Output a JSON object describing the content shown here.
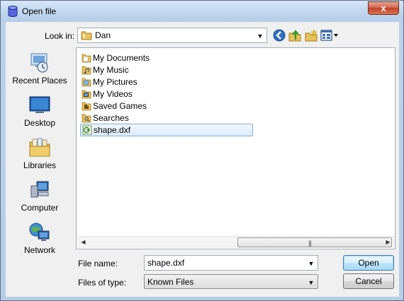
{
  "window": {
    "title": "Open file",
    "close_label": "x"
  },
  "lookin": {
    "label": "Look in:",
    "value": "Dan"
  },
  "places": [
    {
      "label": "Recent Places",
      "icon": "recent-places-icon"
    },
    {
      "label": "Desktop",
      "icon": "desktop-icon"
    },
    {
      "label": "Libraries",
      "icon": "libraries-icon"
    },
    {
      "label": "Computer",
      "icon": "computer-icon"
    },
    {
      "label": "Network",
      "icon": "network-icon"
    }
  ],
  "files": [
    {
      "name": "My Documents",
      "icon": "folder-documents-icon"
    },
    {
      "name": "My Music",
      "icon": "folder-music-icon"
    },
    {
      "name": "My Pictures",
      "icon": "folder-pictures-icon"
    },
    {
      "name": "My Videos",
      "icon": "folder-videos-icon"
    },
    {
      "name": "Saved Games",
      "icon": "folder-games-icon"
    },
    {
      "name": "Searches",
      "icon": "folder-search-icon"
    },
    {
      "name": "shape.dxf",
      "icon": "dxf-file-icon",
      "selected": true
    }
  ],
  "scrollbar": {
    "grip": "|||"
  },
  "filename": {
    "label": "File name:",
    "value": "shape.dxf"
  },
  "filetype": {
    "label": "Files of type:",
    "value": "Known Files"
  },
  "buttons": {
    "open": "Open",
    "cancel": "Cancel"
  },
  "colors": {
    "accent": "#3c7fb1",
    "selection": "#dcebfc",
    "close": "#c2432a"
  }
}
